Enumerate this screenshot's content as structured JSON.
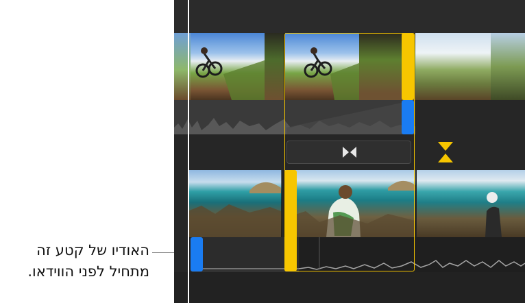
{
  "callout": {
    "text_lines": [
      "האודיו של קטע זה",
      "מתחיל לפני הווידאו."
    ]
  },
  "timeline": {
    "top_track_clips": [
      "clip-bike-1",
      "clip-bike-2",
      "clip-bike-3"
    ],
    "bottom_track_clips": [
      "clip-coast-1",
      "clip-coast-2",
      "clip-coast-3"
    ],
    "transition_icon": "bowtie-transition-icon",
    "precision_icon": "hourglass-precision-icon"
  },
  "colors": {
    "timeline_bg": "#262626",
    "selection": "#f7c600",
    "audio_handle": "#1a7cf2",
    "playhead": "#ffffff",
    "waveform": "#8c8c8c"
  }
}
